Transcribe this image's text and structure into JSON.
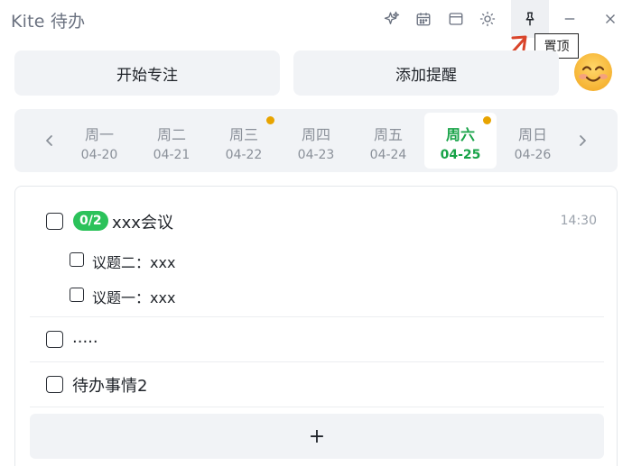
{
  "app": {
    "title": "Kite 待办"
  },
  "titlebar": {
    "icons": [
      "sparkle-icon",
      "calendar-icon",
      "window-icon",
      "theme-sun-icon",
      "pin-icon",
      "minimize-icon",
      "close-icon"
    ],
    "tooltip": "置顶"
  },
  "actions": {
    "focus_label": "开始专注",
    "reminder_label": "添加提醒"
  },
  "colors": {
    "accent": "#18a348",
    "badge": "#2bc25a",
    "dot": "#e8a400",
    "arrow": "#d9452b"
  },
  "week": {
    "days": [
      {
        "name": "周一",
        "date": "04-20",
        "selected": false,
        "dot": false
      },
      {
        "name": "周二",
        "date": "04-21",
        "selected": false,
        "dot": false
      },
      {
        "name": "周三",
        "date": "04-22",
        "selected": false,
        "dot": true
      },
      {
        "name": "周四",
        "date": "04-23",
        "selected": false,
        "dot": false
      },
      {
        "name": "周五",
        "date": "04-24",
        "selected": false,
        "dot": false
      },
      {
        "name": "周六",
        "date": "04-25",
        "selected": true,
        "dot": true
      },
      {
        "name": "周日",
        "date": "04-26",
        "selected": false,
        "dot": false
      }
    ]
  },
  "todos": {
    "items": [
      {
        "badge": "0/2",
        "text": "xxx会议",
        "time": "14:30",
        "subitems": [
          {
            "text": "议题二：xxx"
          },
          {
            "text": "议题一：xxx"
          }
        ]
      },
      {
        "text": "....."
      },
      {
        "text": "待办事情2"
      }
    ],
    "add_label": "+"
  }
}
